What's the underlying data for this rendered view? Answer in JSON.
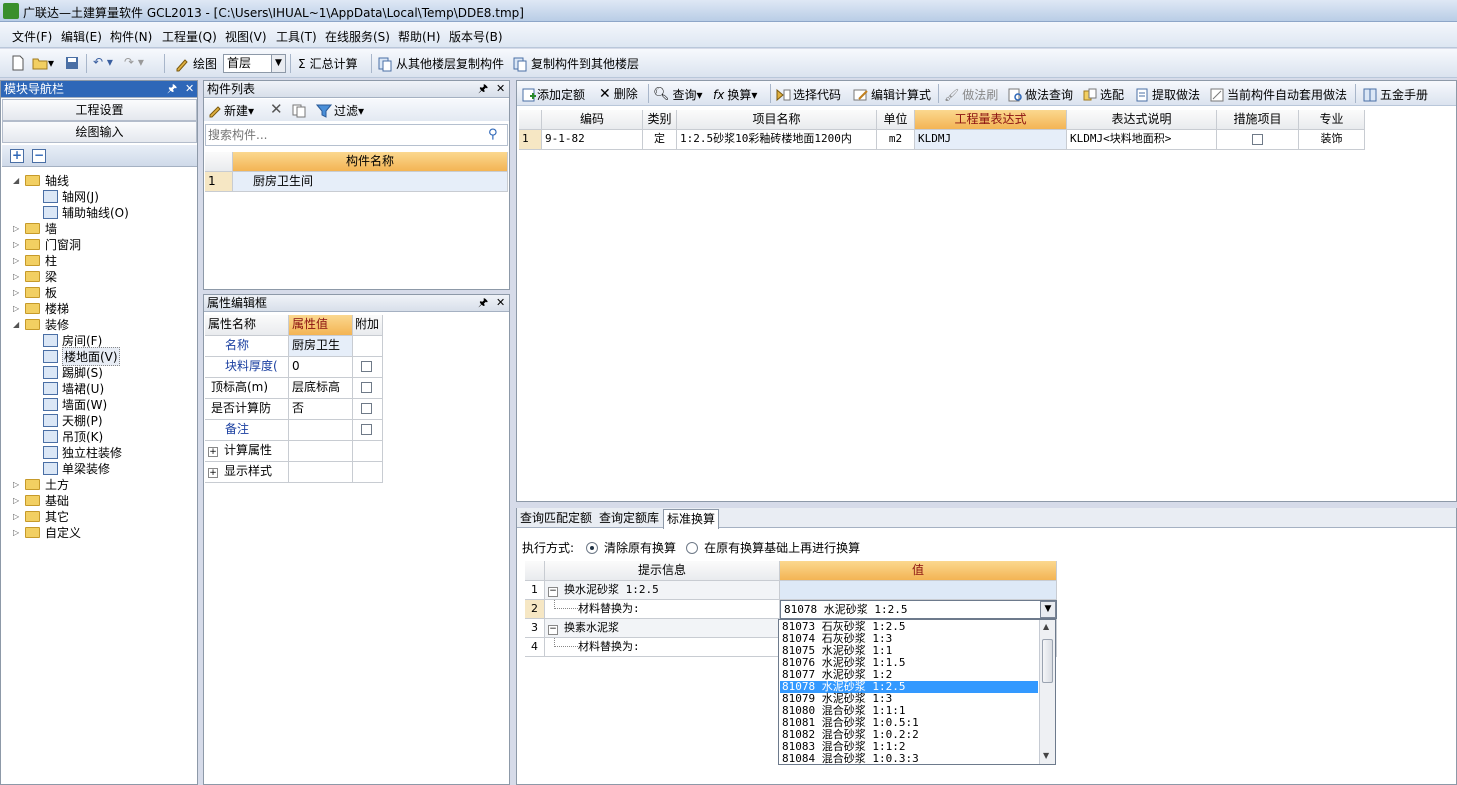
{
  "window": {
    "title": "广联达—土建算量软件 GCL2013 - [C:\\Users\\IHUAL~1\\AppData\\Local\\Temp\\DDE8.tmp]"
  },
  "menu": [
    "文件(F)",
    "编辑(E)",
    "构件(N)",
    "工程量(Q)",
    "视图(V)",
    "工具(T)",
    "在线服务(S)",
    "帮助(H)",
    "版本号(B)"
  ],
  "toolbar": {
    "draw_label": "绘图",
    "floor_value": "首层",
    "sum_label": "汇总计算",
    "copy_from_label": "从其他楼层复制构件",
    "copy_to_label": "复制构件到其他楼层"
  },
  "nav": {
    "title": "模块导航栏",
    "btn_project": "工程设置",
    "btn_draw": "绘图输入",
    "tree": [
      {
        "label": "轴线",
        "level": 0,
        "open": true
      },
      {
        "label": "轴网(J)",
        "level": 1
      },
      {
        "label": "辅助轴线(O)",
        "level": 1
      },
      {
        "label": "墙",
        "level": 0
      },
      {
        "label": "门窗洞",
        "level": 0
      },
      {
        "label": "柱",
        "level": 0
      },
      {
        "label": "梁",
        "level": 0
      },
      {
        "label": "板",
        "level": 0
      },
      {
        "label": "楼梯",
        "level": 0
      },
      {
        "label": "装修",
        "level": 0,
        "open": true
      },
      {
        "label": "房间(F)",
        "level": 1
      },
      {
        "label": "楼地面(V)",
        "level": 1,
        "selected": true
      },
      {
        "label": "踢脚(S)",
        "level": 1
      },
      {
        "label": "墙裙(U)",
        "level": 1
      },
      {
        "label": "墙面(W)",
        "level": 1
      },
      {
        "label": "天棚(P)",
        "level": 1
      },
      {
        "label": "吊顶(K)",
        "level": 1
      },
      {
        "label": "独立柱装修",
        "level": 1
      },
      {
        "label": "单梁装修",
        "level": 1
      },
      {
        "label": "土方",
        "level": 0
      },
      {
        "label": "基础",
        "level": 0
      },
      {
        "label": "其它",
        "level": 0
      },
      {
        "label": "自定义",
        "level": 0
      }
    ]
  },
  "component_list": {
    "title": "构件列表",
    "new_label": "新建",
    "filter_label": "过滤",
    "search_placeholder": "搜索构件...",
    "col_name": "构件名称",
    "rows": [
      {
        "num": "1",
        "name": "厨房卫生间"
      }
    ]
  },
  "property": {
    "title": "属性编辑框",
    "col_name": "属性名称",
    "col_value": "属性值",
    "col_extra": "附加",
    "rows": [
      {
        "name": "名称",
        "value": "厨房卫生",
        "check": false,
        "blue": true
      },
      {
        "name": "块料厚度(",
        "value": "0",
        "check": true,
        "blue": true
      },
      {
        "name": "顶标高(m)",
        "value": "层底标高",
        "check": true,
        "blue": false
      },
      {
        "name": "是否计算防",
        "value": "否",
        "check": true,
        "blue": false
      },
      {
        "name": "备注",
        "value": "",
        "check": true,
        "blue": true
      },
      {
        "name": "计算属性",
        "value": "",
        "check": false,
        "blue": false,
        "expand": true
      },
      {
        "name": "显示样式",
        "value": "",
        "check": false,
        "blue": false,
        "expand": true
      }
    ]
  },
  "quota_toolbar": [
    "添加定额",
    "删除",
    "查询",
    "换算",
    "选择代码",
    "编辑计算式",
    "做法刷",
    "做法查询",
    "选配",
    "提取做法",
    "当前构件自动套用做法",
    "五金手册"
  ],
  "quota_table": {
    "headers": [
      "编码",
      "类别",
      "项目名称",
      "单位",
      "工程量表达式",
      "表达式说明",
      "措施项目",
      "专业"
    ],
    "rows": [
      {
        "num": "1",
        "code": "9-1-82",
        "type": "定",
        "name": "1:2.5砂浆10彩釉砖楼地面1200内",
        "unit": "m2",
        "expr": "KLDMJ",
        "desc": "KLDMJ<块料地面积>",
        "measure": false,
        "major": "装饰"
      }
    ]
  },
  "bottom_tabs": [
    "查询匹配定额",
    "查询定额库",
    "标准换算"
  ],
  "exec": {
    "label": "执行方式:",
    "opt1": "清除原有换算",
    "opt2": "在原有换算基础上再进行换算"
  },
  "conv_table": {
    "col_hint": "提示信息",
    "col_value": "值",
    "rows": [
      {
        "num": "1",
        "hint": "换水泥砂浆 1:2.5",
        "value": "",
        "group": true
      },
      {
        "num": "2",
        "hint": "材料替换为:",
        "value": "81078  水泥砂浆 1:2.5",
        "group": false
      },
      {
        "num": "3",
        "hint": "换素水泥浆",
        "value": "",
        "group": true
      },
      {
        "num": "4",
        "hint": "材料替换为:",
        "value": "",
        "group": false
      }
    ]
  },
  "dropdown": {
    "items": [
      "81073  石灰砂浆 1:2.5",
      "81074  石灰砂浆 1:3",
      "81075  水泥砂浆 1:1",
      "81076  水泥砂浆 1:1.5",
      "81077  水泥砂浆 1:2",
      "81078  水泥砂浆 1:2.5",
      "81079  水泥砂浆 1:3",
      "81080  混合砂浆 1:1:1",
      "81081  混合砂浆 1:0.5:1",
      "81082  混合砂浆 1:0.2:2",
      "81083  混合砂浆 1:1:2",
      "81084  混合砂浆 1:0.3:3"
    ],
    "selected_index": 5
  },
  "colors": {
    "accent": "#2e67b8",
    "header_orange": "#f3b454",
    "selection": "#3399ff"
  }
}
